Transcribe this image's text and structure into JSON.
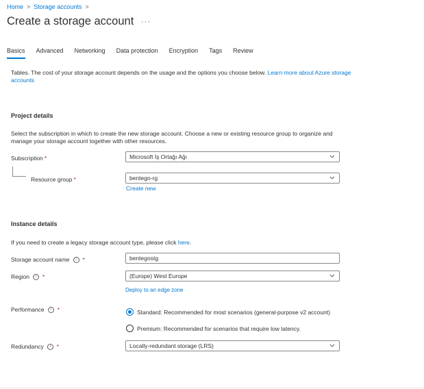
{
  "breadcrumb": {
    "home": "Home",
    "sep": ">",
    "storage_accounts": "Storage accounts"
  },
  "page": {
    "title": "Create a storage account",
    "more": "···"
  },
  "tabs": [
    {
      "label": "Basics"
    },
    {
      "label": "Advanced"
    },
    {
      "label": "Networking"
    },
    {
      "label": "Data protection"
    },
    {
      "label": "Encryption"
    },
    {
      "label": "Tags"
    },
    {
      "label": "Review"
    }
  ],
  "intro": {
    "text": "Tables. The cost of your storage account depends on the usage and the options you choose below. ",
    "link": "Learn more about Azure storage accounts"
  },
  "project": {
    "heading": "Project details",
    "description": "Select the subscription in which to create the new storage account. Choose a new or existing resource group to organize and manage your storage account together with other resources.",
    "subscription_label": "Subscription",
    "subscription_value": "Microsoft İş Ortağı Ağı",
    "resource_group_label": "Resource group",
    "resource_group_value": "bentego-rg",
    "create_new": "Create new"
  },
  "instance": {
    "heading": "Instance details",
    "legacy_text": "If you need to create a legacy storage account type, please click ",
    "legacy_link": "here",
    "legacy_end": ".",
    "name_label": "Storage account name",
    "name_value": "bentegostg",
    "region_label": "Region",
    "region_value": "(Europe) West Europe",
    "edge_zone_link": "Deploy to an edge zone",
    "performance_label": "Performance",
    "performance_standard": "Standard: Recommended for most scenarios (general-purpose v2 account)",
    "performance_premium": "Premium: Recommended for scenarios that require low latency.",
    "redundancy_label": "Redundancy",
    "redundancy_value": "Locally-redundant storage (LRS)"
  },
  "required_mark": "*",
  "info_glyph": "i",
  "colors": {
    "accent": "#0078d4",
    "required": "#a4262c",
    "border": "#8a8886",
    "text": "#323130"
  }
}
